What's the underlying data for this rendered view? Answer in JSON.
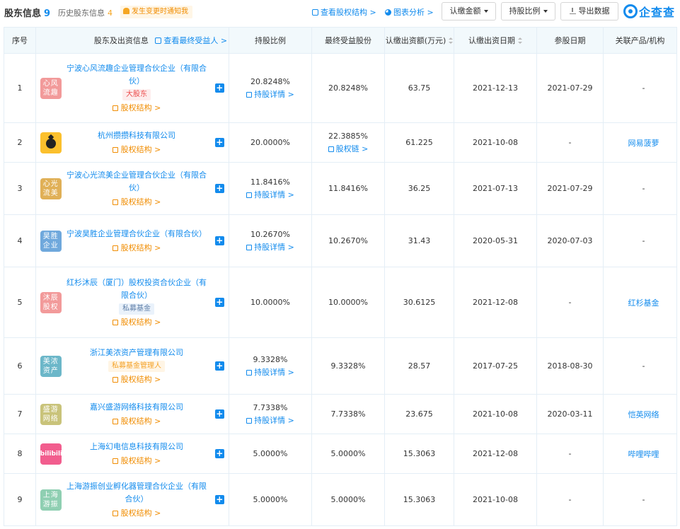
{
  "header": {
    "tab_main": "股东信息",
    "tab_main_count": "9",
    "tab_history": "历史股东信息",
    "tab_history_count": "4",
    "notice": "发生变更时通知我",
    "link_structure": "查看股权结构 >",
    "link_chart": "图表分析 >",
    "btn_amount": "认缴金额",
    "btn_ratio": "持股比例",
    "btn_export": "导出数据",
    "brand": "企查查"
  },
  "table": {
    "columns": {
      "index": "序号",
      "name": "股东及出资信息",
      "beneficiary_link": "查看最终受益人 >",
      "ratio": "持股比例",
      "final_share": "最终受益股份",
      "amount": "认缴出资额(万元)",
      "date": "认缴出资日期",
      "join_date": "参股日期",
      "related": "关联产品/机构"
    },
    "equity_label": "股权结构 >",
    "detail_label": "持股详情 >",
    "chain_label": "股权链 >",
    "rows": [
      {
        "index": "1",
        "logo_text": "心风\n流趣",
        "logo_color": "#f29a9a",
        "name": "宁波心风流趣企业管理合伙企业（有限合伙）",
        "tag": "大股东",
        "tag_type": "red",
        "ratio": "20.8248%",
        "detail": "持股详情 >",
        "final_share": "20.8248%",
        "amount": "63.75",
        "date": "2021-12-13",
        "join_date": "2021-07-29",
        "related": "-"
      },
      {
        "index": "2",
        "logo_type": "pine",
        "name": "杭州攒攒科技有限公司",
        "ratio": "20.0000%",
        "final_share": "22.3885%",
        "final_detail": "股权链 >",
        "amount": "61.225",
        "date": "2021-10-08",
        "join_date": "-",
        "related": "网易菠萝"
      },
      {
        "index": "3",
        "logo_text": "心光\n流美",
        "logo_color": "#e0b057",
        "name": "宁波心光流美企业管理合伙企业（有限合伙）",
        "ratio": "11.8416%",
        "detail": "持股详情 >",
        "final_share": "11.8416%",
        "amount": "36.25",
        "date": "2021-07-13",
        "join_date": "2021-07-29",
        "related": "-"
      },
      {
        "index": "4",
        "logo_text": "昊胜\n企业",
        "logo_color": "#6fa8dc",
        "name": "宁波昊胜企业管理合伙企业（有限合伙）",
        "ratio": "10.2670%",
        "detail": "持股详情 >",
        "final_share": "10.2670%",
        "amount": "31.43",
        "date": "2020-05-31",
        "join_date": "2020-07-03",
        "related": "-"
      },
      {
        "index": "5",
        "logo_text": "沐辰\n股权",
        "logo_color": "#f29a9a",
        "name": "红杉沐辰（厦门）股权投资合伙企业（有限合伙）",
        "tag": "私募基金",
        "tag_type": "blue",
        "ratio": "10.0000%",
        "final_share": "10.0000%",
        "amount": "30.6125",
        "date": "2021-12-08",
        "join_date": "-",
        "related": "红杉基金"
      },
      {
        "index": "6",
        "logo_text": "美浓\n资产",
        "logo_color": "#6cb7c9",
        "name": "浙江美浓资产管理有限公司",
        "tag": "私募基金管理人",
        "tag_type": "org",
        "ratio": "9.3328%",
        "detail": "持股详情 >",
        "final_share": "9.3328%",
        "amount": "28.57",
        "date": "2017-07-25",
        "join_date": "2018-08-30",
        "related": "-"
      },
      {
        "index": "7",
        "logo_text": "盛游\n网络",
        "logo_color": "#c9c37a",
        "name": "嘉兴盛游网络科技有限公司",
        "ratio": "7.7338%",
        "detail": "持股详情 >",
        "final_share": "7.7338%",
        "amount": "23.675",
        "date": "2021-10-08",
        "join_date": "2020-03-11",
        "related": "恺英网络"
      },
      {
        "index": "8",
        "logo_type": "bili",
        "logo_text": "bilibili",
        "name": "上海幻电信息科技有限公司",
        "ratio": "5.0000%",
        "final_share": "5.0000%",
        "amount": "15.3063",
        "date": "2021-12-08",
        "join_date": "-",
        "related": "哔哩哔哩"
      },
      {
        "index": "9",
        "logo_text": "上海\n游振",
        "logo_color": "#8fcfb2",
        "name": "上海游振创业孵化器管理合伙企业（有限合伙）",
        "ratio": "5.0000%",
        "final_share": "5.0000%",
        "amount": "15.3063",
        "date": "2021-10-08",
        "join_date": "-",
        "related": "-"
      }
    ]
  },
  "colors": {
    "accent": "#128bed",
    "equity_orange": "#f08c00",
    "header_bg": "#f2f9fc"
  },
  "icons": [
    "bell-icon",
    "structure-icon",
    "pie-chart-icon",
    "download-icon",
    "qcc-logo-icon",
    "equity-icon",
    "detail-icon",
    "chain-icon",
    "plus-icon",
    "sort-icon",
    "caret-down-icon"
  ]
}
